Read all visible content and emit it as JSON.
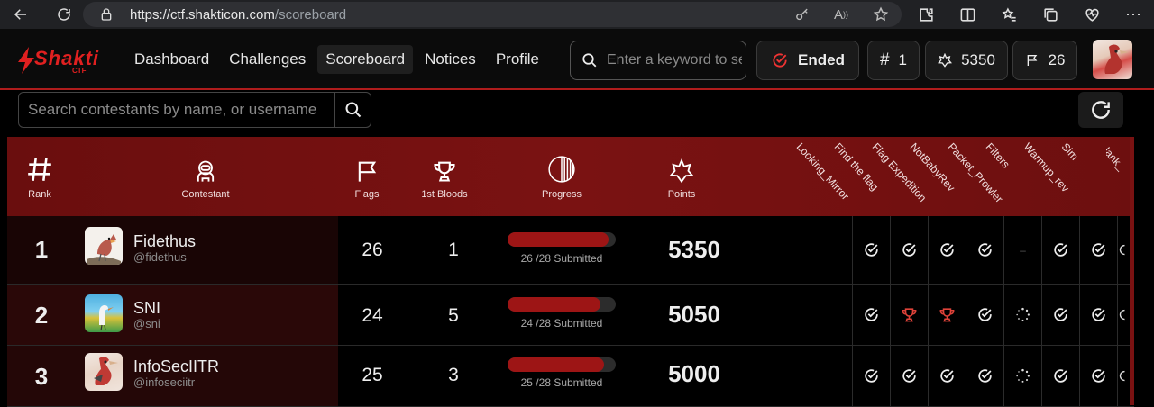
{
  "browser": {
    "url_host": "https://ctf.shakticon.com",
    "url_path": "/scoreboard"
  },
  "header": {
    "logo_text": "Shakti",
    "logo_sub": "CTF",
    "nav": [
      "Dashboard",
      "Challenges",
      "Scoreboard",
      "Notices",
      "Profile"
    ],
    "active_nav": "Scoreboard",
    "search_placeholder": "Enter a keyword to search",
    "status": "Ended",
    "rank": "1",
    "points": "5350",
    "flags": "26"
  },
  "contestant_search": {
    "placeholder": "Search contestants by name, or username"
  },
  "table": {
    "columns": {
      "rank": "Rank",
      "contestant": "Contestant",
      "flags": "Flags",
      "bloods": "1st Bloods",
      "progress": "Progress",
      "points": "Points"
    },
    "challenges": [
      "Looking_Mirror",
      "Find the flag",
      "Flag Expedition",
      "NotBabyRev",
      "Packet_Prowler",
      "Filters",
      "Warmup_rev",
      "Sim",
      "blank_"
    ],
    "rows": [
      {
        "rank": "1",
        "name": "Fidethus",
        "username": "@fidethus",
        "flags": "26",
        "bloods": "1",
        "progress": 0.93,
        "progress_text": "26 /28 Submitted",
        "points": "5350",
        "cells": [
          "check",
          "check",
          "check",
          "check",
          "dash",
          "check",
          "check",
          "partial"
        ]
      },
      {
        "rank": "2",
        "name": "SNI",
        "username": "@sni",
        "flags": "24",
        "bloods": "5",
        "progress": 0.86,
        "progress_text": "24 /28 Submitted",
        "points": "5050",
        "cells": [
          "check",
          "trophy",
          "trophy",
          "check",
          "spinner",
          "check",
          "check",
          "partial"
        ]
      },
      {
        "rank": "3",
        "name": "InfoSecIITR",
        "username": "@infoseciitr",
        "flags": "25",
        "bloods": "3",
        "progress": 0.89,
        "progress_text": "25 /28 Submitted",
        "points": "5000",
        "cells": [
          "check",
          "check",
          "check",
          "check",
          "spinner",
          "check",
          "check",
          "partial"
        ]
      }
    ]
  },
  "colors": {
    "accent": "#b01c1c",
    "header_bg": "#6a0e0e",
    "trophy": "#e0433a"
  }
}
